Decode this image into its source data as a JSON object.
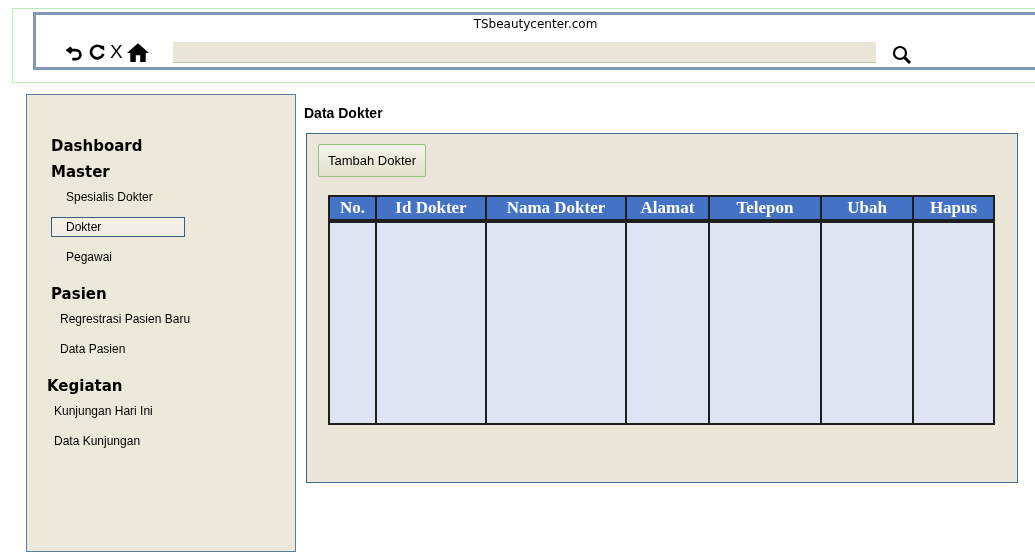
{
  "browser": {
    "title": "TSbeautycenter.com",
    "close_label": "X"
  },
  "sidebar": {
    "sections": [
      {
        "title": "Dashboard"
      },
      {
        "title": "Master",
        "items": [
          {
            "label": "Spesialis Dokter",
            "selected": false
          },
          {
            "label": "Dokter",
            "selected": true
          },
          {
            "label": "Pegawai",
            "selected": false
          }
        ]
      },
      {
        "title": "Pasien",
        "items": [
          {
            "label": "Regrestrasi Pasien Baru",
            "selected": false
          },
          {
            "label": "Data Pasien",
            "selected": false
          }
        ]
      },
      {
        "title": "Kegiatan",
        "items": [
          {
            "label": "Kunjungan Hari Ini",
            "selected": false
          },
          {
            "label": "Data Kunjungan",
            "selected": false
          }
        ]
      }
    ]
  },
  "page": {
    "title": "Data Dokter",
    "add_button": "Tambah Dokter"
  },
  "table": {
    "columns": [
      "No.",
      "Id Dokter",
      "Nama Dokter",
      "Alamat",
      "Telepon",
      "Ubah",
      "Hapus"
    ]
  }
}
